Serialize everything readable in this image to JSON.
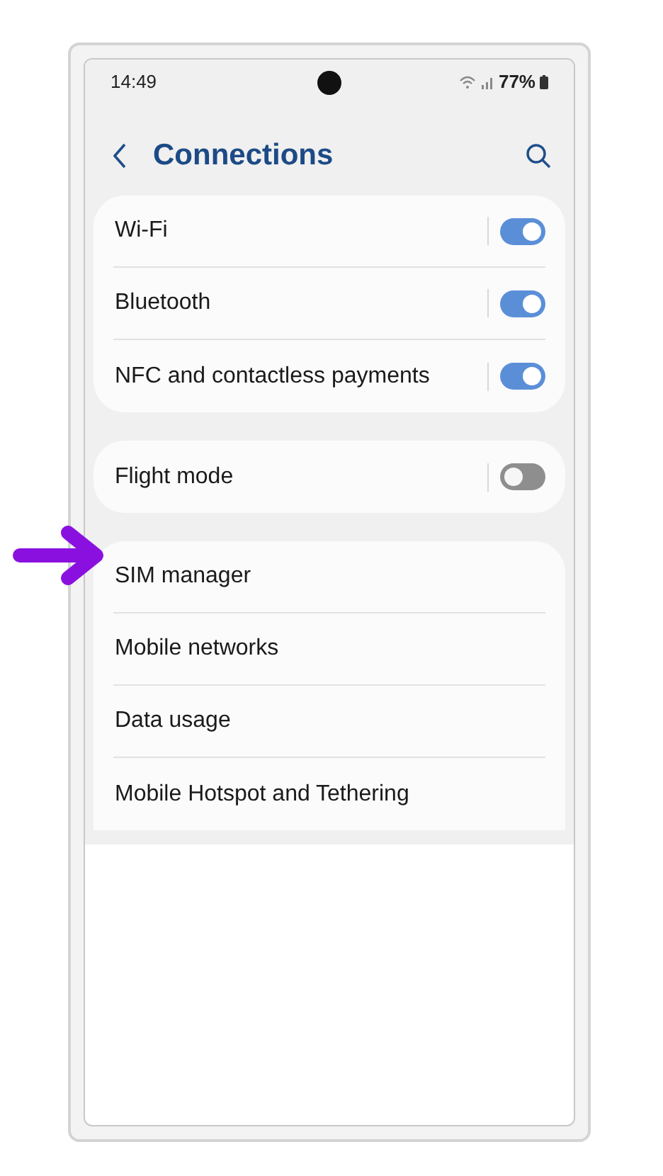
{
  "status_bar": {
    "time": "14:49",
    "battery": "77%"
  },
  "header": {
    "title": "Connections"
  },
  "groups": [
    {
      "items": [
        {
          "label": "Wi-Fi",
          "kind": "toggle",
          "on": true
        },
        {
          "label": "Bluetooth",
          "kind": "toggle",
          "on": true
        },
        {
          "label": "NFC and contactless payments",
          "kind": "toggle",
          "on": true
        }
      ]
    },
    {
      "items": [
        {
          "label": "Flight mode",
          "kind": "toggle",
          "on": false
        }
      ]
    },
    {
      "items": [
        {
          "label": "SIM manager",
          "kind": "link"
        },
        {
          "label": "Mobile networks",
          "kind": "link"
        },
        {
          "label": "Data usage",
          "kind": "link"
        },
        {
          "label": "Mobile Hotspot and Tethering",
          "kind": "link"
        }
      ]
    }
  ]
}
